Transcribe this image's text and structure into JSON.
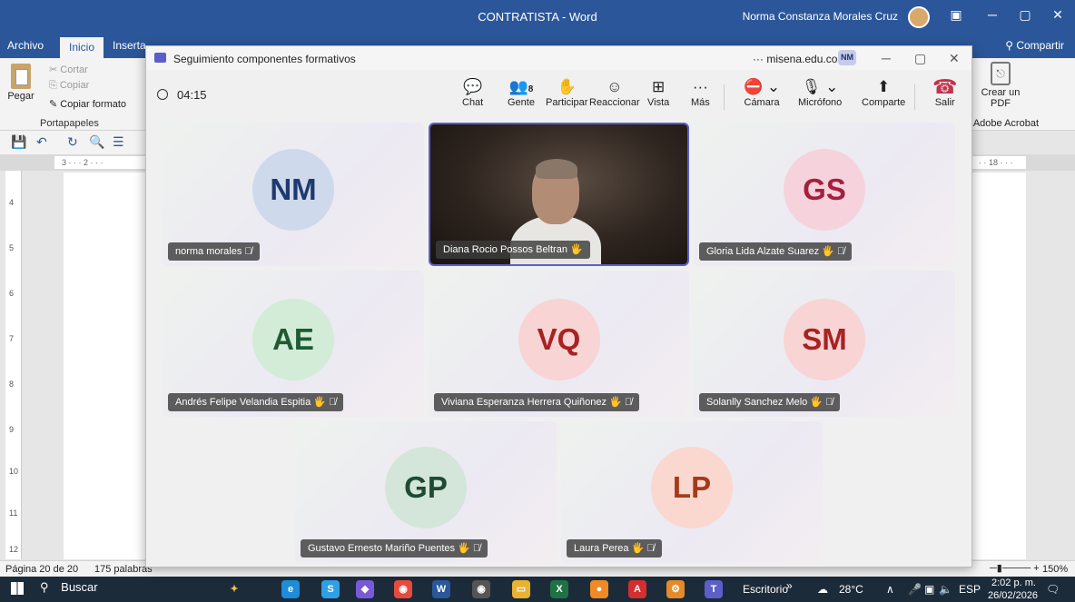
{
  "word": {
    "title": "CONTRATISTA  -  Word",
    "user_name": "Norma Constanza Morales Cruz",
    "tabs": [
      "Archivo",
      "Inicio",
      "Inserta"
    ],
    "share_label": "Compartir",
    "ribbon": {
      "paste_label": "Pegar",
      "cut_label": "Cortar",
      "copy_label": "Copiar",
      "format_painter_label": "Copiar formato",
      "clipboard_group": "Portapapeles",
      "create_pdf_label": "Crear un PDF",
      "adobe_group": "Adobe Acrobat"
    },
    "ruler": {
      "left_marks": "3 · · · 2 · · ·",
      "right_marks": "· · 18 · · ·"
    },
    "vruler_marks": [
      "4",
      "5",
      "6",
      "7",
      "8",
      "9",
      "10",
      "11",
      "12"
    ],
    "status": {
      "page": "Página 20 de 20",
      "words": "175 palabras",
      "zoom": "150%"
    }
  },
  "teams": {
    "window_title": "Seguimiento componentes formativos",
    "domain": "misena.edu.co",
    "account_initials": "NM",
    "timer": "04:15",
    "toolbar": {
      "chat": "Chat",
      "people": "Gente",
      "people_count": "8",
      "raise": "Participar",
      "react": "Reaccionar",
      "view": "Vista",
      "more": "Más",
      "camera": "Cámara",
      "mic": "Micrófono",
      "share": "Comparte",
      "leave": "Salir"
    },
    "participants": [
      {
        "initials": "NM",
        "name": "norma morales",
        "avatar_bg": "#cfd9ec",
        "avatar_fg": "#1e3a6e"
      },
      {
        "initials": "",
        "name": "Diana Rocio Possos Beltran",
        "avatar_bg": "",
        "avatar_fg": ""
      },
      {
        "initials": "GS",
        "name": "Gloria Lida Alzate Suarez",
        "avatar_bg": "#f6d3dc",
        "avatar_fg": "#a4203f"
      },
      {
        "initials": "AE",
        "name": "Andrés Felipe Velandia Espitia",
        "avatar_bg": "#d3ecd8",
        "avatar_fg": "#1f5a33"
      },
      {
        "initials": "VQ",
        "name": "Viviana Esperanza Herrera Quiñonez",
        "avatar_bg": "#f8d4d4",
        "avatar_fg": "#a82222"
      },
      {
        "initials": "SM",
        "name": "Solanlly Sanchez Melo",
        "avatar_bg": "#f8d4d4",
        "avatar_fg": "#a82222"
      },
      {
        "initials": "GP",
        "name": "Gustavo Ernesto Mariño Puentes",
        "avatar_bg": "#d3e6d9",
        "avatar_fg": "#1f4a33"
      },
      {
        "initials": "LP",
        "name": "Laura Perea",
        "avatar_bg": "#fad8cf",
        "avatar_fg": "#a53a1b"
      }
    ]
  },
  "taskbar": {
    "search": "Buscar",
    "desktop_label": "Escritorio",
    "temperature": "28°C",
    "language": "ESP",
    "time": "2:02 p. m.",
    "date": "26/02/2026"
  }
}
